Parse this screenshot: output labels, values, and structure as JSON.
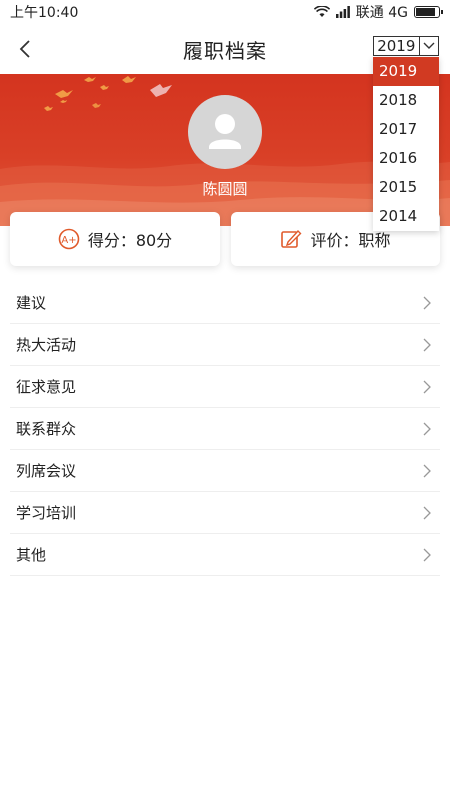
{
  "status_bar": {
    "time": "上午10:40",
    "carrier": "联通 4G",
    "icons": [
      "wifi-icon",
      "signal-icon",
      "battery-icon"
    ]
  },
  "nav": {
    "title": "履职档案",
    "back_icon": "chevron-left-icon"
  },
  "year_select": {
    "value": "2019",
    "options": [
      "2019",
      "2018",
      "2017",
      "2016",
      "2015",
      "2014"
    ],
    "selected": "2019"
  },
  "profile": {
    "name": "陈圆圆",
    "avatar_icon": "user-placeholder-icon"
  },
  "cards": {
    "score": {
      "icon": "a-plus-badge-icon",
      "label": "得分：80分"
    },
    "evaluation": {
      "icon": "edit-icon",
      "label": "评价：职称"
    }
  },
  "menu": {
    "items": [
      {
        "label": "建议"
      },
      {
        "label": "热大活动"
      },
      {
        "label": "征求意见"
      },
      {
        "label": "联系群众"
      },
      {
        "label": "列席会议"
      },
      {
        "label": "学习培训"
      },
      {
        "label": "其他"
      }
    ]
  },
  "colors": {
    "accent": "#d13a22",
    "banner": "#d4341f",
    "icon_orange": "#e05a2b"
  }
}
